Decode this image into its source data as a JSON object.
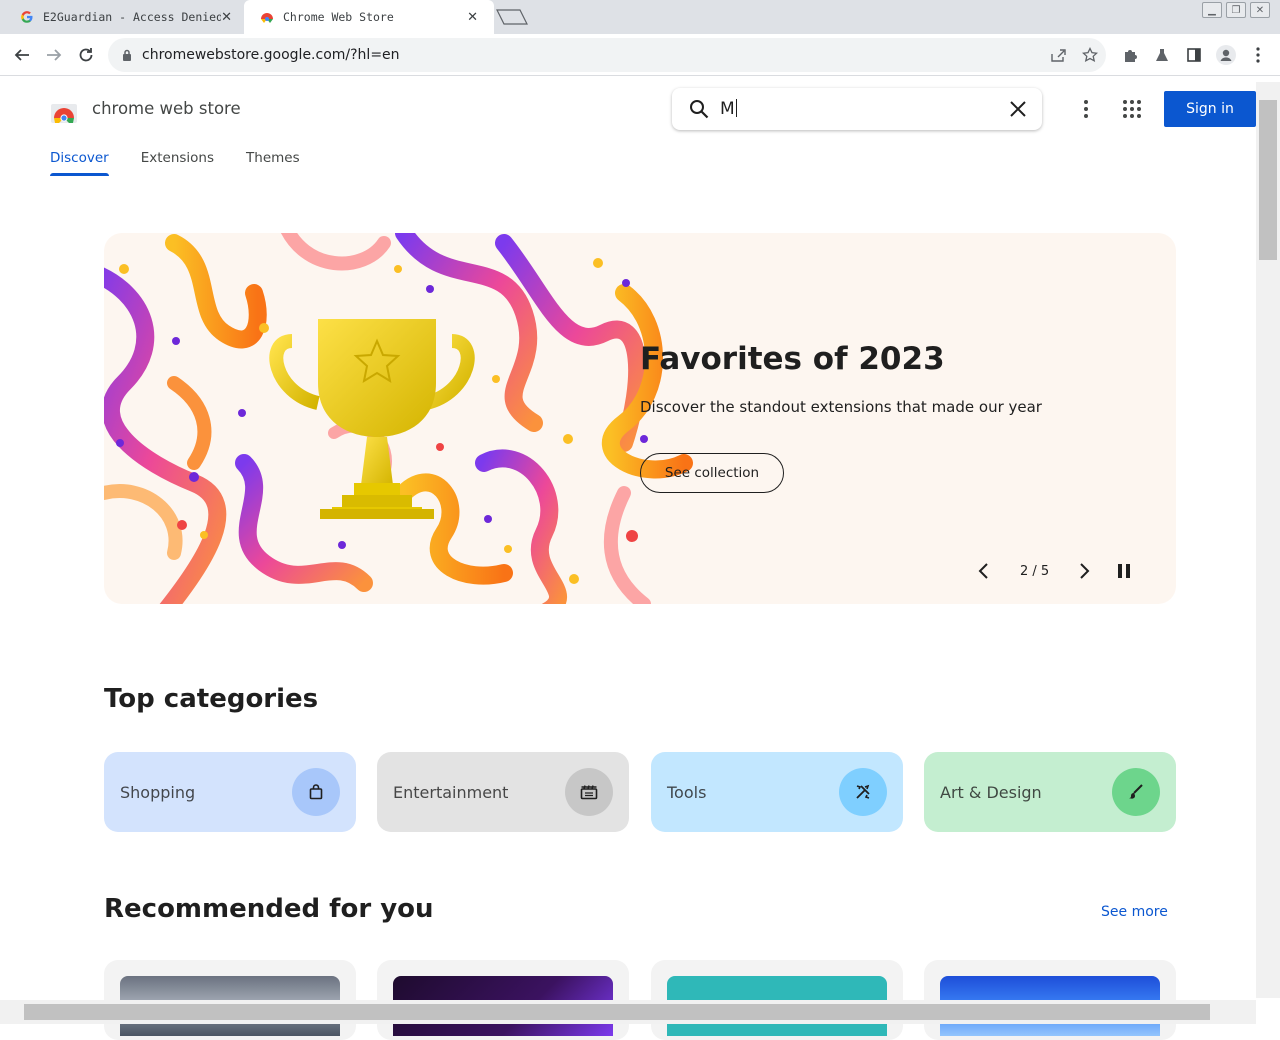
{
  "browser": {
    "tabs": [
      {
        "title": "E2Guardian - Access Denied",
        "active": false
      },
      {
        "title": "Chrome Web Store",
        "active": true
      }
    ],
    "url": "chromewebstore.google.com/?hl=en"
  },
  "store": {
    "name": "chrome web store",
    "search_value": "M",
    "sign_in": "Sign in",
    "nav": [
      "Discover",
      "Extensions",
      "Themes"
    ],
    "active_nav": "Discover"
  },
  "hero": {
    "title": "Favorites of 2023",
    "subtitle": "Discover the standout extensions that made our year",
    "button": "See collection",
    "counter": "2 / 5"
  },
  "top_categories": {
    "heading": "Top categories",
    "items": [
      {
        "label": "Shopping",
        "icon": "shopping-bag-icon",
        "bg": "#d3e3fd",
        "icon_bg": "#a8c7fa"
      },
      {
        "label": "Entertainment",
        "icon": "clapperboard-icon",
        "bg": "#e3e3e3",
        "icon_bg": "#c7c7c7"
      },
      {
        "label": "Tools",
        "icon": "tools-icon",
        "bg": "#c2e7ff",
        "icon_bg": "#7fcfff"
      },
      {
        "label": "Art & Design",
        "icon": "brush-icon",
        "bg": "#c4eed0",
        "icon_bg": "#6dd58c"
      }
    ]
  },
  "recommended": {
    "heading": "Recommended for you",
    "see_more": "See more"
  },
  "colors": {
    "accent": "#0b57d0",
    "hero_bg": "#fdf6f0"
  }
}
